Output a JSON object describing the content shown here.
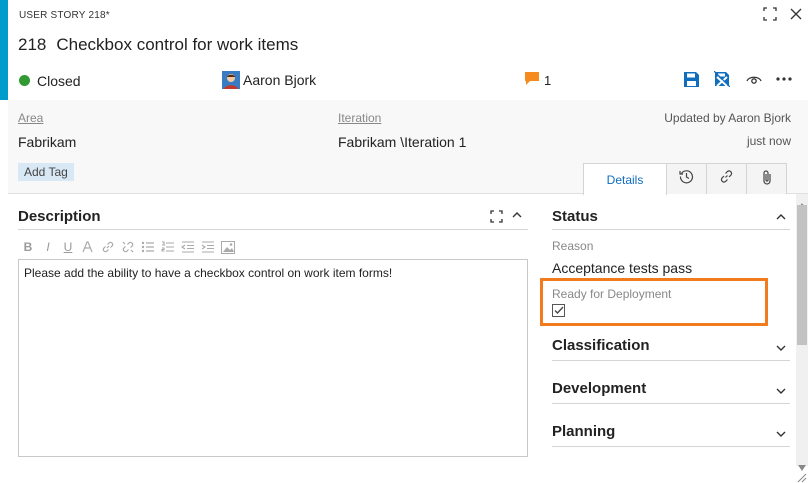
{
  "header": {
    "work_item_type": "USER STORY 218*",
    "id": "218",
    "title": "Checkbox control for work items",
    "state": "Closed",
    "assigned_to": "Aaron Bjork",
    "comment_count": "1"
  },
  "fields": {
    "area_label": "Area",
    "area_value": "Fabrikam",
    "iteration_label": "Iteration",
    "iteration_value": "Fabrikam \\Iteration 1",
    "updated_by": "Updated by Aaron Bjork",
    "updated_when": "just now",
    "add_tag": "Add Tag"
  },
  "tabs": {
    "details": "Details"
  },
  "description": {
    "title": "Description",
    "toolbar": {
      "bold": "B",
      "italic": "I",
      "underline": "U"
    },
    "content": "Please add the ability to have a checkbox control on work item forms!"
  },
  "status": {
    "title": "Status",
    "reason_label": "Reason",
    "reason_value": "Acceptance tests pass",
    "ready_label": "Ready for Deployment",
    "ready_checked": true
  },
  "groups": {
    "classification": "Classification",
    "development": "Development",
    "planning": "Planning"
  },
  "colors": {
    "accent": "#009ccc",
    "closed_state": "#339933",
    "highlight": "#f27c1d",
    "toolbar_icon": "#106ebe",
    "comment_icon": "#f58b1f",
    "tag_background": "#d9e8f5"
  },
  "icons": {
    "maximize": "maximize-icon",
    "close": "close-icon",
    "comment": "comment-icon",
    "save": "save-icon",
    "save_close": "save-and-close-icon",
    "follow": "follow-icon",
    "more": "more-actions-icon",
    "history": "history-icon",
    "links": "link-icon",
    "attachments": "attachment-icon"
  }
}
